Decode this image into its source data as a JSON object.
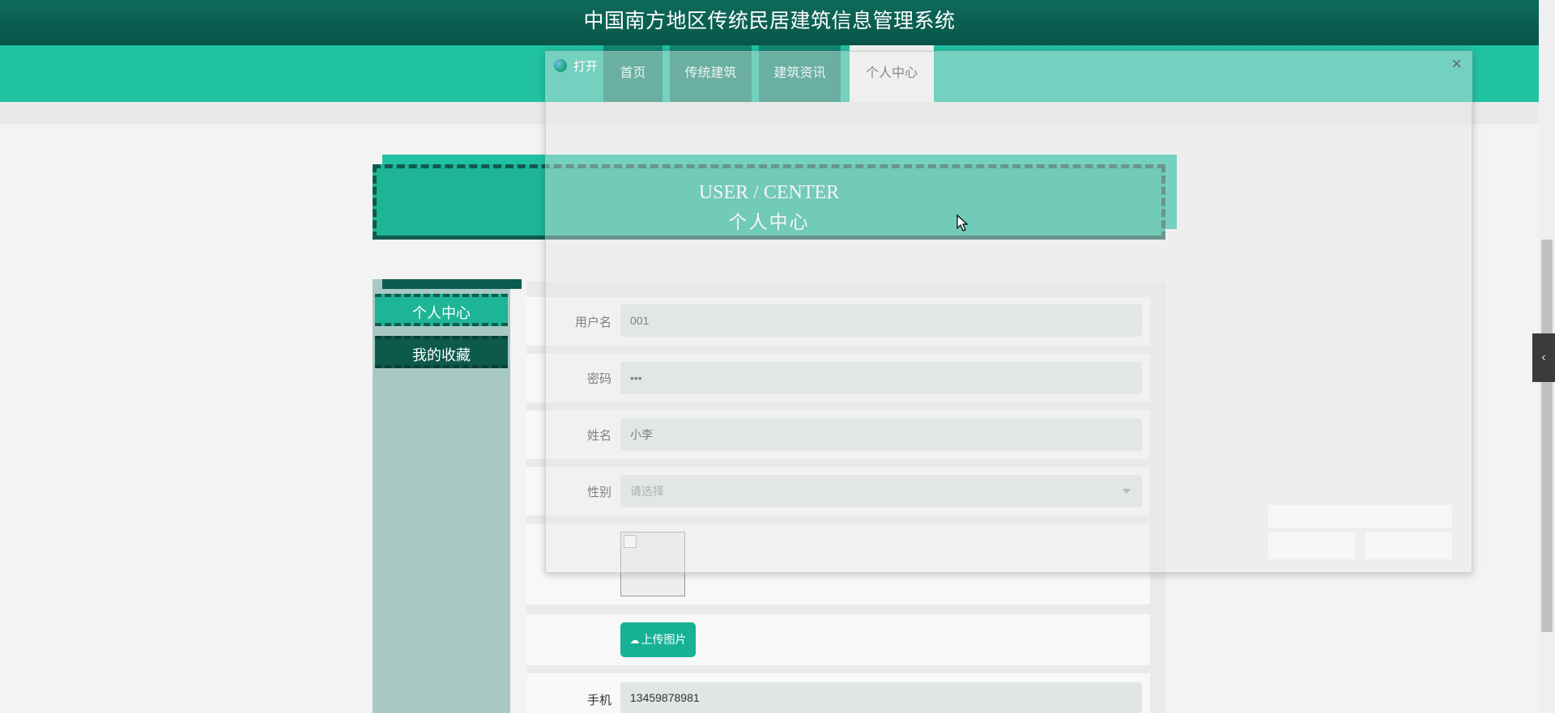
{
  "app": {
    "title": "中国南方地区传统民居建筑信息管理系统"
  },
  "nav": {
    "items": [
      {
        "label": "首页"
      },
      {
        "label": "传统建筑"
      },
      {
        "label": "建筑资讯"
      },
      {
        "label": "个人中心"
      }
    ],
    "active": "个人中心"
  },
  "overlay": {
    "open_label": "打开",
    "close_glyph": "×"
  },
  "banner": {
    "en": "USER / CENTER",
    "cn": "个人中心"
  },
  "sidebar": {
    "items": [
      {
        "label": "个人中心"
      },
      {
        "label": "我的收藏"
      }
    ]
  },
  "form": {
    "username": {
      "label": "用户名",
      "value": "001"
    },
    "password": {
      "label": "密码",
      "value": "•••"
    },
    "name": {
      "label": "姓名",
      "value": "小李"
    },
    "gender": {
      "label": "性别",
      "placeholder": "请选择"
    },
    "upload_label": "上传图片",
    "phone": {
      "label": "手机",
      "value": "13459878981"
    }
  },
  "side_toggle_glyph": "‹",
  "colors": {
    "brand_dark": "#075548",
    "brand_teal": "#21c2a2",
    "button_teal": "#17b294"
  }
}
